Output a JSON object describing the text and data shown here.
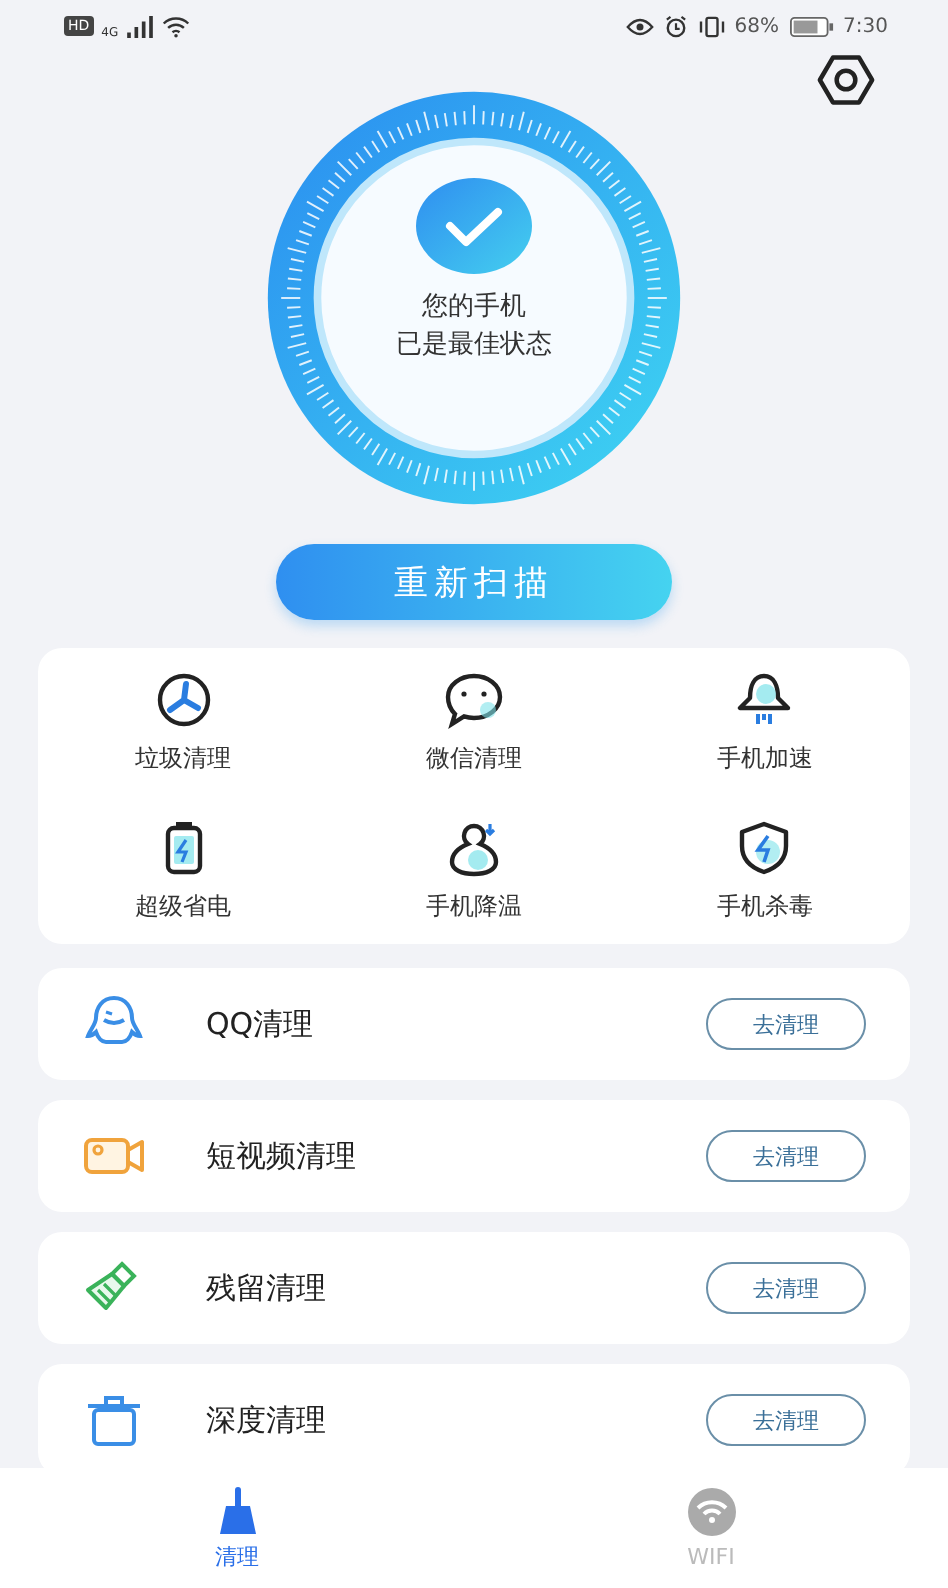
{
  "status_bar": {
    "badges": [
      "HD",
      "4G"
    ],
    "battery_percent": "68%",
    "time": "7:30"
  },
  "scan": {
    "lines": [
      "您的手机",
      "已是最佳状态"
    ],
    "button": "重新扫描"
  },
  "tools": [
    {
      "label": "垃圾清理",
      "kind": "fan"
    },
    {
      "label": "微信清理",
      "kind": "chat"
    },
    {
      "label": "手机加速",
      "kind": "rocket"
    },
    {
      "label": "超级省电",
      "kind": "battery"
    },
    {
      "label": "手机降温",
      "kind": "gourd"
    },
    {
      "label": "手机杀毒",
      "kind": "shield"
    }
  ],
  "cleaners": [
    {
      "label": "QQ清理",
      "kind": "penguin",
      "action": "去清理"
    },
    {
      "label": "短视频清理",
      "kind": "camera",
      "action": "去清理"
    },
    {
      "label": "残留清理",
      "kind": "broom",
      "action": "去清理"
    },
    {
      "label": "深度清理",
      "kind": "bin",
      "action": "去清理"
    }
  ],
  "tabs": [
    {
      "label": "清理",
      "kind": "broom",
      "selected": true
    },
    {
      "label": "WIFI",
      "kind": "wifi",
      "selected": false
    }
  ]
}
